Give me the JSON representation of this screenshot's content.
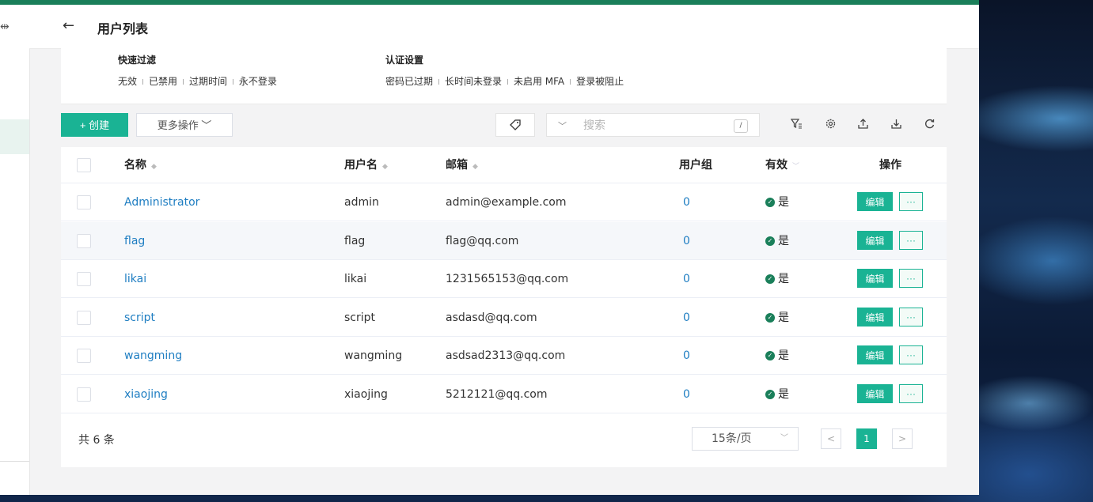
{
  "header": {
    "back_icon": "arrow-left-icon",
    "title": "用户列表"
  },
  "filters": {
    "quick": {
      "heading": "快速过滤",
      "items": [
        "无效",
        "已禁用",
        "过期时间",
        "永不登录"
      ]
    },
    "auth": {
      "heading": "认证设置",
      "items": [
        "密码已过期",
        "长时间未登录",
        "未启用 MFA",
        "登录被阻止"
      ]
    },
    "separator": "I"
  },
  "toolbar": {
    "create_label": "+ 创建",
    "more_label": "更多操作 ﹀",
    "search_placeholder": "搜索",
    "search_shortcut": "/",
    "icons": [
      "tag-icon",
      "filter-icon",
      "settings-icon",
      "export-icon",
      "import-icon",
      "refresh-icon"
    ]
  },
  "table": {
    "columns": {
      "name": "名称",
      "username": "用户名",
      "email": "邮箱",
      "groups": "用户组",
      "active": "有效",
      "actions": "操作"
    },
    "edit_label": "编辑",
    "more_label": "···",
    "rows": [
      {
        "name": "Administrator",
        "username": "admin",
        "email": "admin@example.com",
        "groups": "0",
        "active": "是"
      },
      {
        "name": "flag",
        "username": "flag",
        "email": "flag@qq.com",
        "groups": "0",
        "active": "是"
      },
      {
        "name": "likai",
        "username": "likai",
        "email": "1231565153@qq.com",
        "groups": "0",
        "active": "是"
      },
      {
        "name": "script",
        "username": "script",
        "email": "asdasd@qq.com",
        "groups": "0",
        "active": "是"
      },
      {
        "name": "wangming",
        "username": "wangming",
        "email": "asdsad2313@qq.com",
        "groups": "0",
        "active": "是"
      },
      {
        "name": "xiaojing",
        "username": "xiaojing",
        "email": "5212121@qq.com",
        "groups": "0",
        "active": "是"
      }
    ]
  },
  "footer": {
    "total": "共 6 条",
    "page_size": "15条/页",
    "current_page": "1",
    "prev": "<",
    "next": ">"
  },
  "colors": {
    "brand_green": "#1ab394",
    "header_bar": "#1a7f5a",
    "link_blue": "#1f7ec2"
  }
}
